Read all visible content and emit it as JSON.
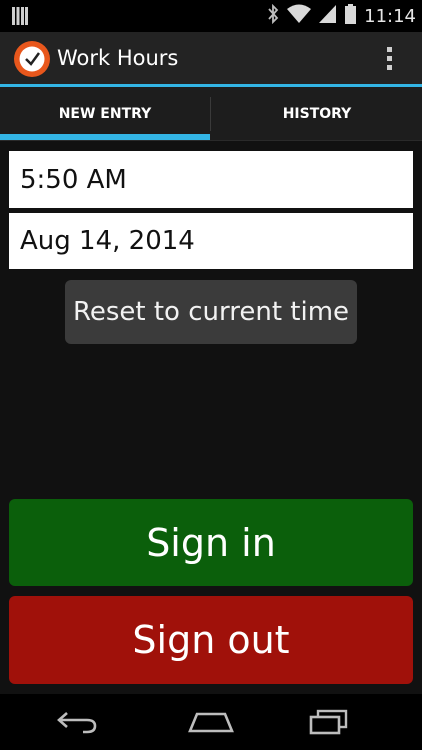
{
  "status_bar": {
    "time": "11:14",
    "icons": [
      "notification-bars-icon",
      "bluetooth-icon",
      "wifi-icon",
      "signal-icon",
      "battery-icon"
    ]
  },
  "action_bar": {
    "title": "Work Hours",
    "icon": "clock-icon",
    "overflow_icon": "overflow-menu-icon"
  },
  "tabs": [
    {
      "label": "NEW ENTRY",
      "selected": true
    },
    {
      "label": "HISTORY",
      "selected": false
    }
  ],
  "form": {
    "time_value": "5:50 AM",
    "date_value": "Aug 14, 2014",
    "reset_label": "Reset to current time"
  },
  "actions": {
    "sign_in_label": "Sign in",
    "sign_out_label": "Sign out"
  },
  "nav_bar": {
    "icons": [
      "back-icon",
      "home-icon",
      "recents-icon"
    ]
  },
  "colors": {
    "accent": "#33b5e5",
    "sign_in": "#0b5f0b",
    "sign_out": "#a0110a",
    "app_icon": "#e8571c"
  }
}
